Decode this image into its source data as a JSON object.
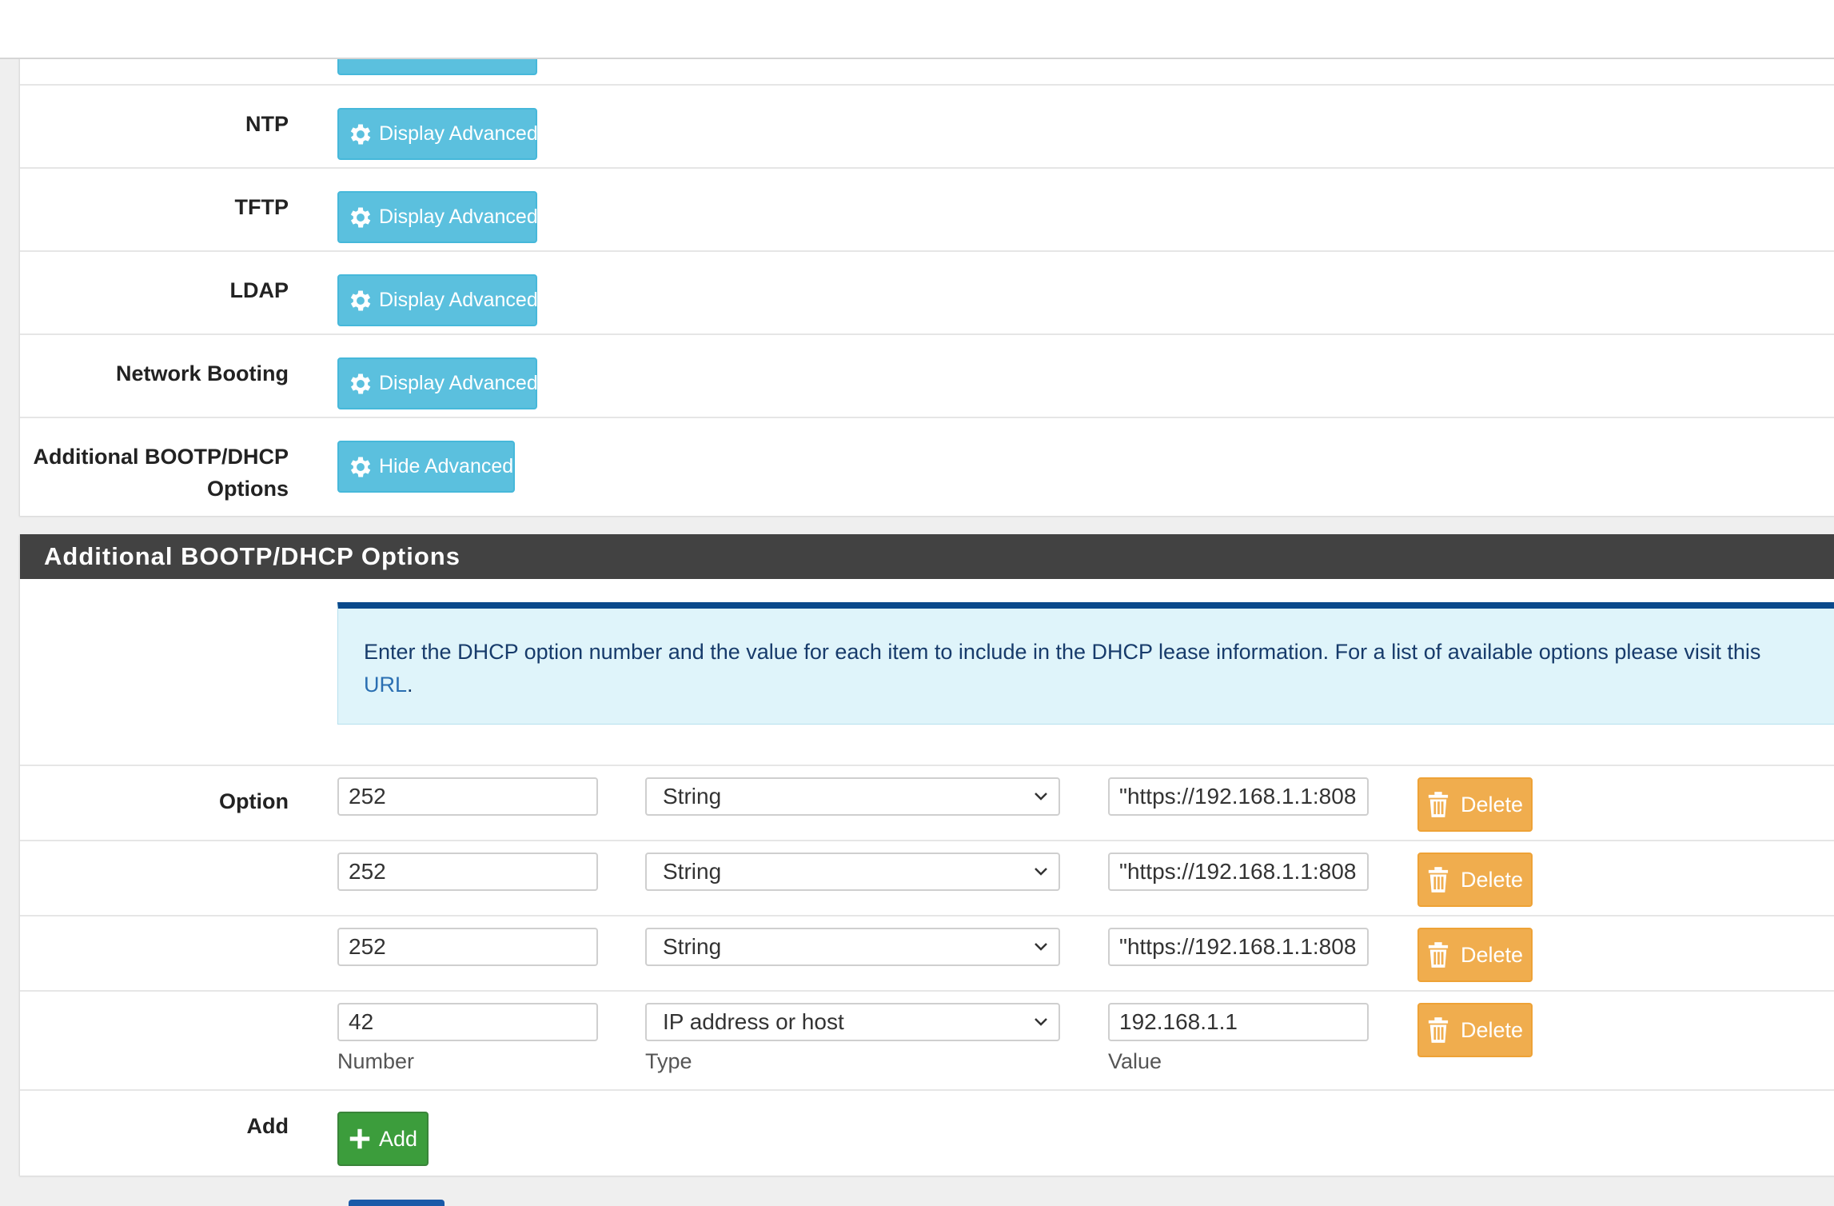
{
  "sections": {
    "advanced_rows": [
      {
        "label": "NTP",
        "button": "Display Advanced"
      },
      {
        "label": "TFTP",
        "button": "Display Advanced"
      },
      {
        "label": "LDAP",
        "button": "Display Advanced"
      },
      {
        "label": "Network Booting",
        "button": "Display Advanced"
      },
      {
        "label_line1": "Additional BOOTP/DHCP",
        "label_line2": "Options",
        "button": "Hide Advanced"
      }
    ]
  },
  "options_panel": {
    "heading": "Additional BOOTP/DHCP Options",
    "info_text": "Enter the DHCP option number and the value for each item to include in the DHCP lease information. For a list of available options please visit this ",
    "info_link": "URL",
    "info_suffix": ".",
    "option_label": "Option",
    "rows": [
      {
        "number": "252",
        "type": "String",
        "value": "\"https://192.168.1.1:808",
        "delete": "Delete"
      },
      {
        "number": "252",
        "type": "String",
        "value": "\"https://192.168.1.1:808",
        "delete": "Delete"
      },
      {
        "number": "252",
        "type": "String",
        "value": "\"https://192.168.1.1:808",
        "delete": "Delete"
      },
      {
        "number": "42",
        "type": "IP address or host",
        "value": "192.168.1.1",
        "delete": "Delete"
      }
    ],
    "col_labels": {
      "number": "Number",
      "type": "Type",
      "value": "Value"
    },
    "add_label": "Add",
    "add_button": "Add"
  },
  "colors": {
    "info": "#5bc0de",
    "warning": "#f0ad4e",
    "success": "#3c9d3c",
    "heading_bg": "#424242",
    "info_border": "#0a4a8c"
  }
}
